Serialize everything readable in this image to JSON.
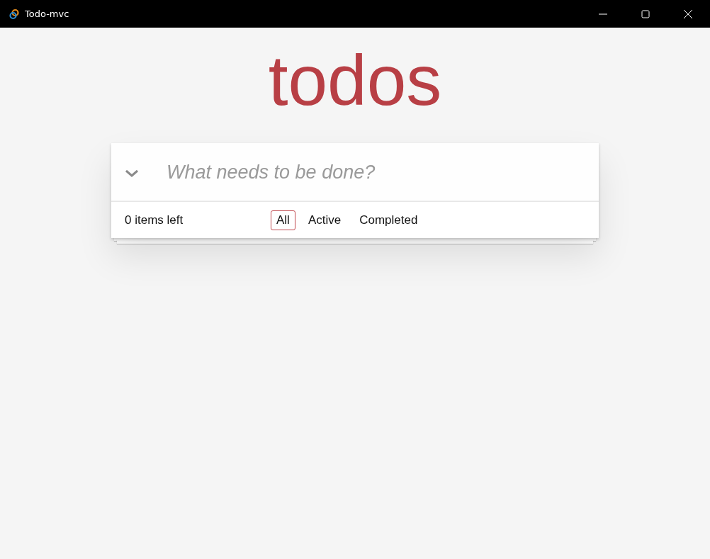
{
  "window": {
    "title": "Todo-mvc"
  },
  "heading": "todos",
  "new_todo": {
    "placeholder": "What needs to be done?"
  },
  "footer": {
    "count": "0 items left",
    "filters": [
      {
        "label": "All",
        "selected": true
      },
      {
        "label": "Active",
        "selected": false
      },
      {
        "label": "Completed",
        "selected": false
      }
    ]
  }
}
